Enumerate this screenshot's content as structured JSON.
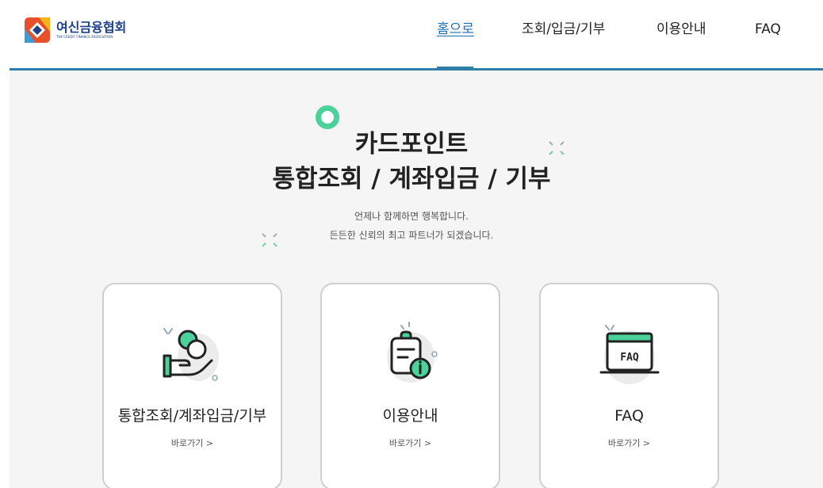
{
  "header": {
    "logo": {
      "name_ko": "여신금융협회",
      "name_en": "THE CREDIT FINANCE ASSOCIATION"
    },
    "nav": [
      {
        "label": "홈으로",
        "active": true
      },
      {
        "label": "조회/입금/기부",
        "active": false
      },
      {
        "label": "이용안내",
        "active": false
      },
      {
        "label": "FAQ",
        "active": false
      }
    ]
  },
  "hero": {
    "title_line1": "카드포인트",
    "title_line2": "통합조회 / 계좌입금 / 기부",
    "subtitle_line1": "언제나 함께하면 행복합니다.",
    "subtitle_line2": "든든한 신뢰의 최고 파트너가 되겠습니다."
  },
  "cards": [
    {
      "title": "통합조회/계좌입금/기부",
      "link": "바로가기 >",
      "icon": "hand-coin-icon"
    },
    {
      "title": "이용안내",
      "link": "바로가기 >",
      "icon": "clipboard-info-icon"
    },
    {
      "title": "FAQ",
      "link": "바로가기 >",
      "icon": "faq-monitor-icon"
    }
  ],
  "colors": {
    "accent": "#4bd19a",
    "header_line": "#2f7ea8",
    "nav_active": "#1f6fb5",
    "logo_text": "#1d3f8c",
    "background": "#f5f5f5"
  }
}
